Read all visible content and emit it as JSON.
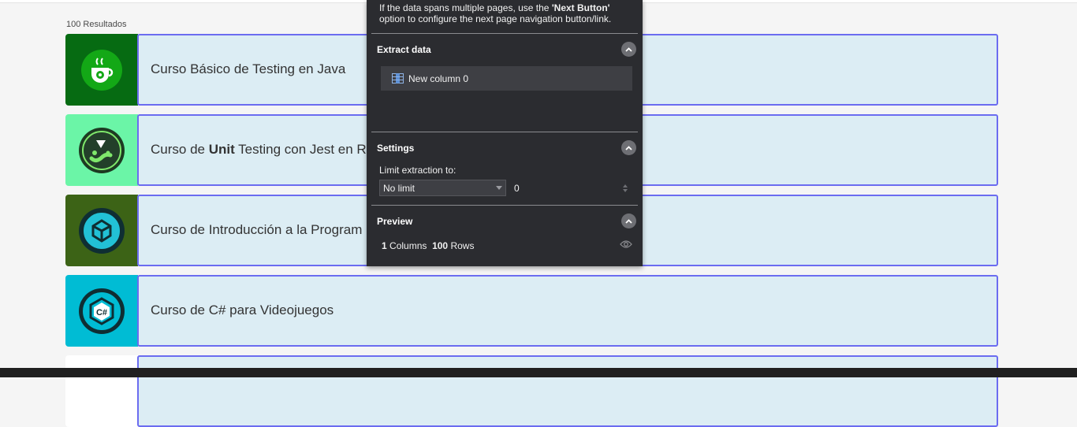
{
  "results_count": "100 Resultados",
  "courses": [
    {
      "title_pre": "Curso Básico de Testing en Java",
      "title_bold": "",
      "title_post": "",
      "bg": "#066b12",
      "icon": "java-coffee-icon"
    },
    {
      "title_pre": "Curso de ",
      "title_bold": "Unit",
      "title_post": " Testing con Jest en R",
      "bg": "#6bf5a7",
      "icon": "jest-icon"
    },
    {
      "title_pre": "Curso de Introducción a la Program",
      "title_bold": "",
      "title_post": "",
      "bg": "#3c6316",
      "icon": "unity-icon"
    },
    {
      "title_pre": "Curso de C# para Videojuegos",
      "title_bold": "",
      "title_post": "",
      "bg": "#00bcd4",
      "icon": "csharp-icon"
    }
  ],
  "panel": {
    "hint_text_1": "If the data spans multiple pages, use the ",
    "hint_bold": "'Next Button'",
    "hint_text_2": " option to configure the next page navigation button/link.",
    "extract_title": "Extract data",
    "column_label": "New column 0",
    "settings_title": "Settings",
    "limit_label": "Limit extraction to:",
    "limit_value": "No limit",
    "limit_number": "0",
    "preview_title": "Preview",
    "preview_columns_count": "1",
    "preview_columns_label": "Columns",
    "preview_rows_count": "100",
    "preview_rows_label": "Rows"
  },
  "colors": {
    "card_bg": "#dcedf4",
    "card_border": "#6b6cf0",
    "panel_bg": "#2b2c30"
  }
}
